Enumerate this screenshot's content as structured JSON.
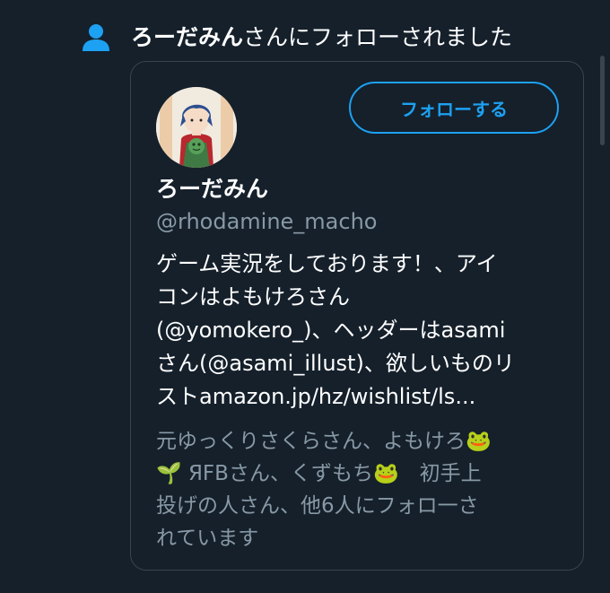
{
  "notification": {
    "icon": "person-icon",
    "name": "ろーだみん",
    "action_text": "さんにフォローされました"
  },
  "profile_card": {
    "follow_button_label": "フォローする",
    "display_name": "ろーだみん",
    "handle": "@rhodamine_macho",
    "bio": "ゲーム実況をしております！、アイ\nコンはよもけろさん\n(@yomokero_)、ヘッダーはasami\nさん(@asami_illust)、欲しいものリ\nストamazon.jp/hz/wishlist/ls...",
    "followed_by": "元ゆっくりさくらさん、よもけろ🐸\n🌱 ЯFBさん、くずもち🐸　初手上\n投げの人さん、他6人にフォロ一さ\nれています"
  },
  "colors": {
    "background": "#15202b",
    "accent": "#1da1f2",
    "secondary_text": "#8899a6",
    "border": "#38444d"
  }
}
